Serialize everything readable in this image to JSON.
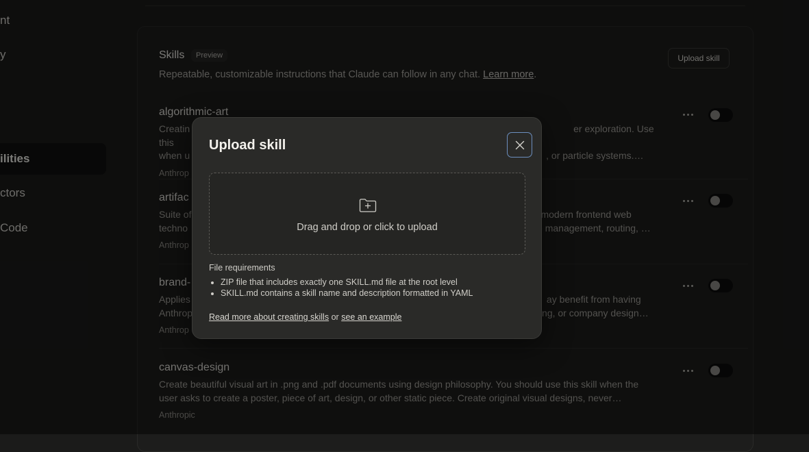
{
  "sidebar": {
    "items": [
      {
        "label": "nt",
        "active": false
      },
      {
        "label": "y",
        "active": false
      },
      {
        "label": "ilities",
        "active": true
      },
      {
        "label": "ctors",
        "active": false
      },
      {
        "label": " Code",
        "active": false
      }
    ]
  },
  "skills": {
    "title": "Skills",
    "badge": "Preview",
    "upload_button": "Upload skill",
    "subtitle": "Repeatable, customizable instructions that Claude can follow in any chat.",
    "learn_more": "Learn more",
    "subtitle_end": ".",
    "items": [
      {
        "name": "algorithmic-art",
        "line1": "Creatin",
        "line1b": "er exploration. Use this",
        "line2": "when u",
        "line2b": ", or particle systems.…",
        "author": "Anthrop",
        "enabled": false
      },
      {
        "name": "artifac",
        "line1": "Suite of",
        "line1b": "modern frontend web",
        "line2": "techno",
        "line2b": "e management, routing, …",
        "author": "Anthrop",
        "enabled": false
      },
      {
        "name": "brand-",
        "line1": "Applies",
        "line1b": "ay benefit from having",
        "line2": "Anthrop",
        "line2b": "ng, or company design…",
        "author": "Anthrop",
        "enabled": false
      },
      {
        "name": "canvas-design",
        "line1": "Create beautiful visual art in .png and .pdf documents using design philosophy. You should use this skill when the",
        "line1b": "",
        "line2": "user asks to create a poster, piece of art, design, or other static piece. Create original visual designs, never…",
        "line2b": "",
        "author": "Anthropic",
        "enabled": false
      }
    ]
  },
  "modal": {
    "title": "Upload skill",
    "drop_text": "Drag and drop or click to upload",
    "requirements_title": "File requirements",
    "requirements": [
      "ZIP file that includes exactly one SKILL.md file at the root level",
      "SKILL.md contains a skill name and description formatted in YAML"
    ],
    "link_read_more": "Read more about creating skills",
    "link_or": "or",
    "link_example": "see an example"
  }
}
